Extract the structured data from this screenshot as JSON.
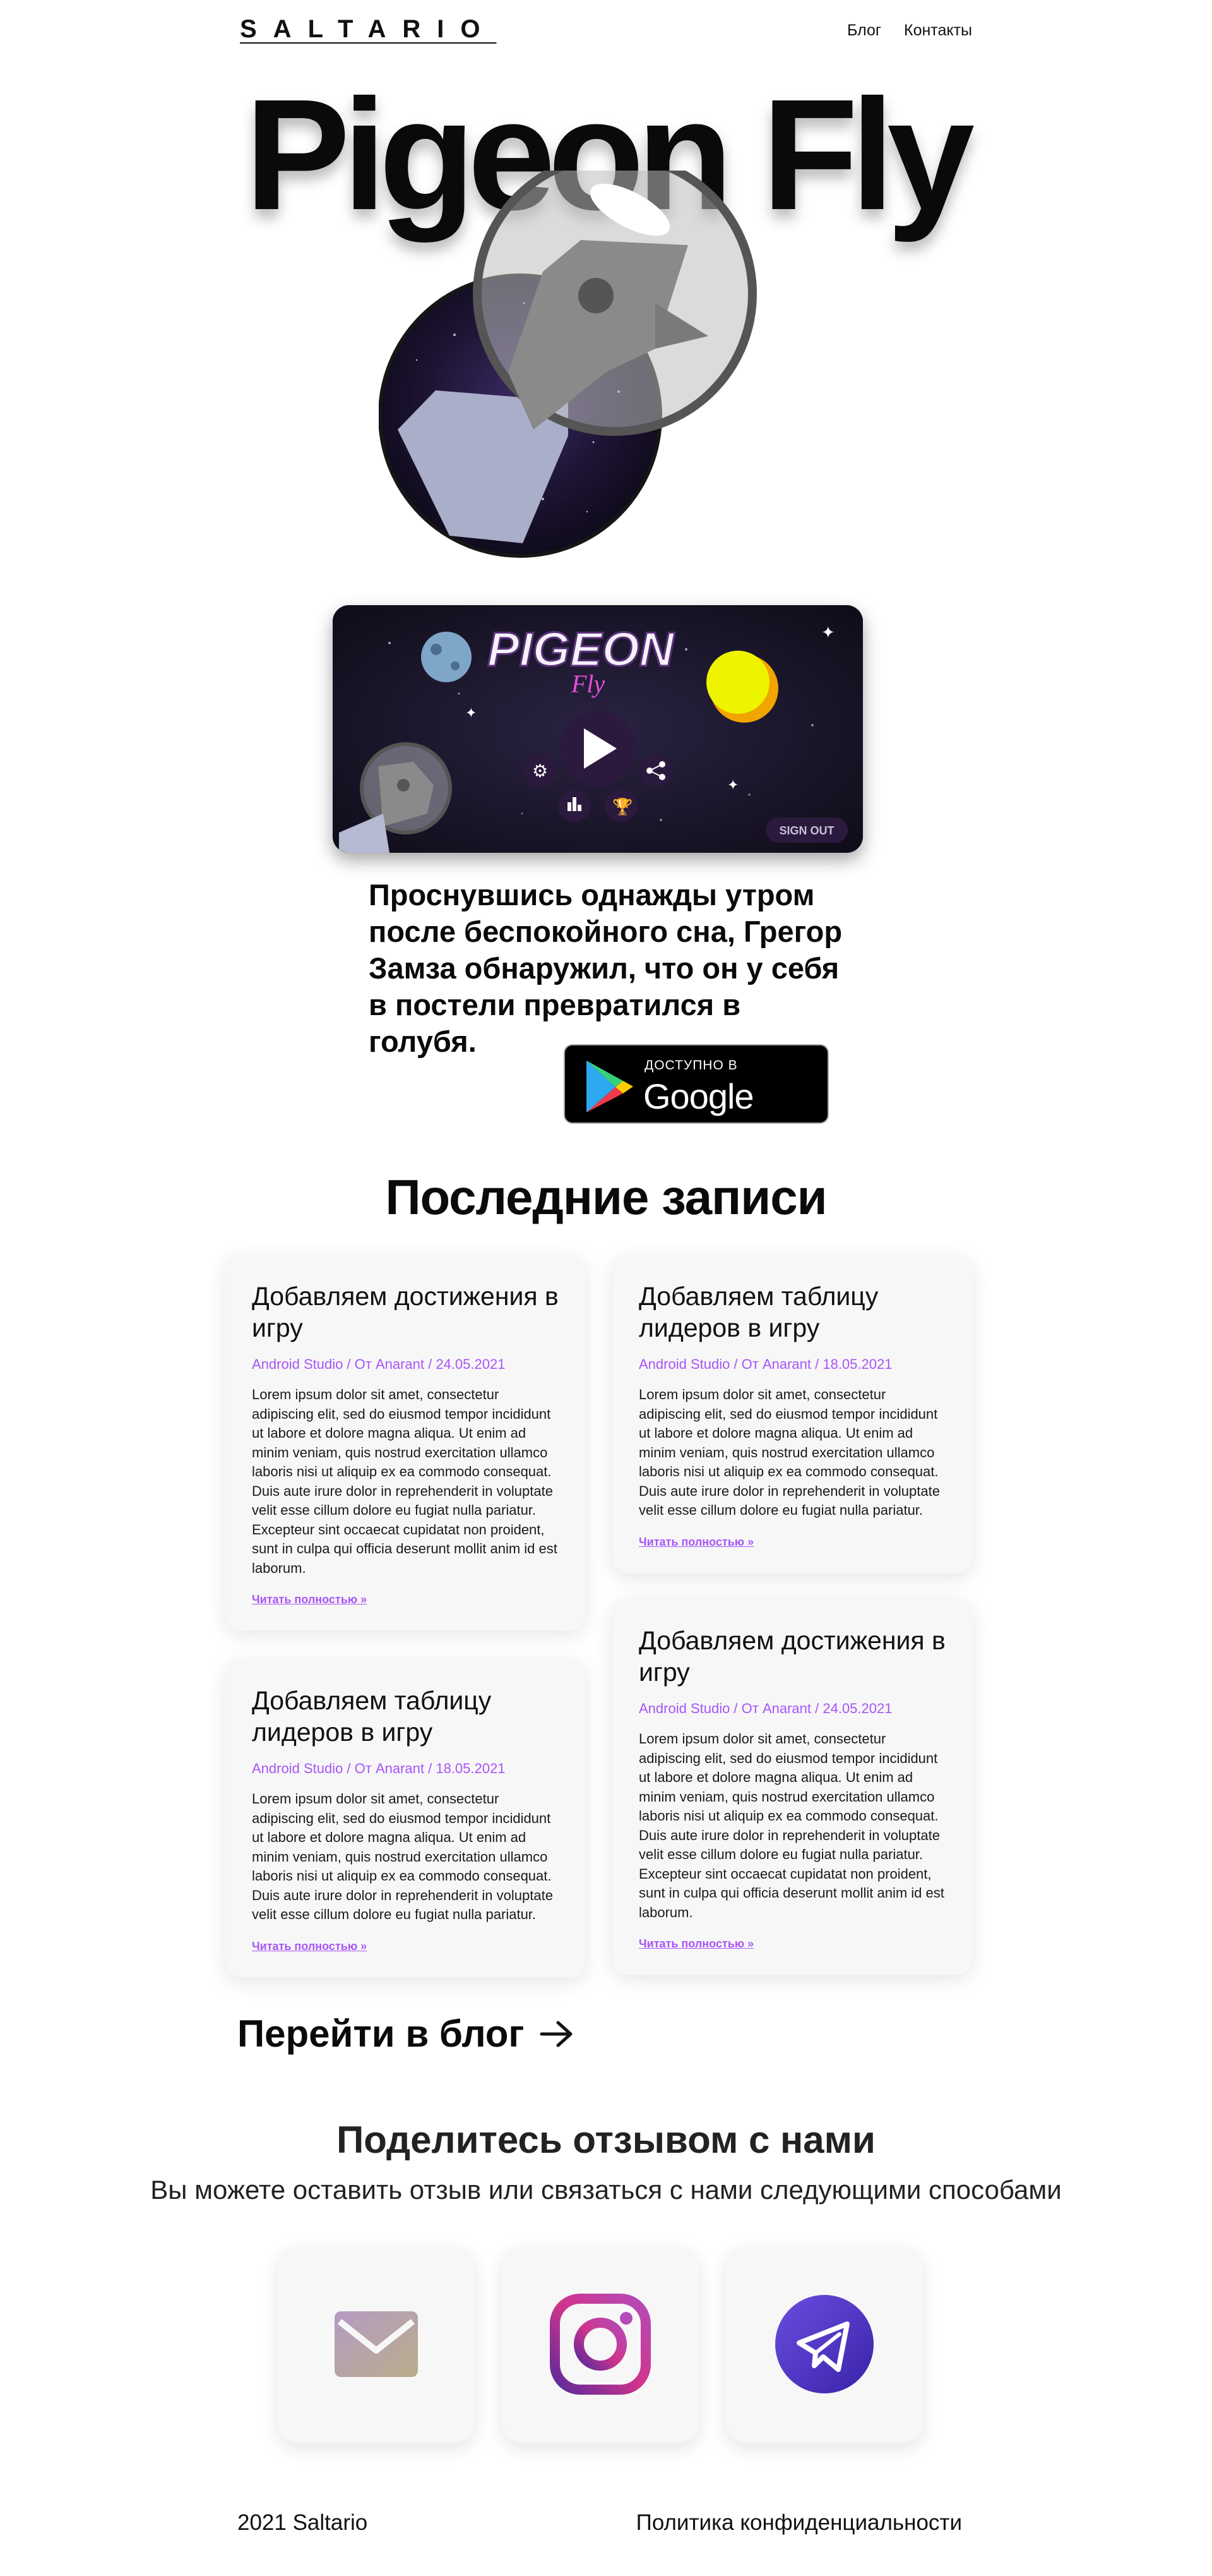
{
  "header": {
    "logo": "SALTARIO",
    "nav": {
      "blog": "Блог",
      "contacts": "Контакты"
    }
  },
  "hero": {
    "title": "Pigeon Fly"
  },
  "game_screen": {
    "logo_main": "PIGEON",
    "logo_sub": "Fly",
    "sign_out": "SIGN OUT"
  },
  "tagline": "Проснувшись однажды утром после беспокойного сна, Грегор Замза обнаружил, что он у себя в постели превратился в голубя.",
  "google_play": {
    "small": "ДОСТУПНО В",
    "big": "Google Play"
  },
  "latest": {
    "title": "Последние записи",
    "posts": [
      {
        "title": "Добавляем достижения в игру",
        "meta": "Android Studio / От Anarant / 24.05.2021",
        "body": "Lorem ipsum dolor sit amet, consectetur adipiscing elit, sed do eiusmod tempor incididunt ut labore et dolore magna aliqua. Ut enim ad minim veniam, quis nostrud exercitation ullamco laboris nisi ut aliquip ex ea commodo consequat. Duis aute irure dolor in reprehenderit in voluptate velit esse cillum dolore eu fugiat nulla pariatur. Excepteur sint occaecat cupidatat non proident, sunt in culpa qui officia deserunt mollit anim id est laborum.",
        "more": "Читать полностью »"
      },
      {
        "title": "Добавляем таблицу лидеров в игру",
        "meta": "Android Studio / От Anarant / 18.05.2021",
        "body": "Lorem ipsum dolor sit amet, consectetur adipiscing elit, sed do eiusmod tempor incididunt ut labore et dolore magna aliqua. Ut enim ad minim veniam, quis nostrud exercitation ullamco laboris nisi ut aliquip ex ea commodo consequat. Duis aute irure dolor in reprehenderit in voluptate velit esse cillum dolore eu fugiat nulla pariatur.",
        "more": "Читать полностью »"
      },
      {
        "title": "Добавляем таблицу лидеров в игру",
        "meta": "Android Studio / От Anarant / 18.05.2021",
        "body": "Lorem ipsum dolor sit amet, consectetur adipiscing elit, sed do eiusmod tempor incididunt ut labore et dolore magna aliqua. Ut enim ad minim veniam, quis nostrud exercitation ullamco laboris nisi ut aliquip ex ea commodo consequat. Duis aute irure dolor in reprehenderit in voluptate velit esse cillum dolore eu fugiat nulla pariatur.",
        "more": "Читать полностью »"
      },
      {
        "title": "Добавляем достижения в игру",
        "meta": "Android Studio / От Anarant / 24.05.2021",
        "body": "Lorem ipsum dolor sit amet, consectetur adipiscing elit, sed do eiusmod tempor incididunt ut labore et dolore magna aliqua. Ut enim ad minim veniam, quis nostrud exercitation ullamco laboris nisi ut aliquip ex ea commodo consequat. Duis aute irure dolor in reprehenderit in voluptate velit esse cillum dolore eu fugiat nulla pariatur. Excepteur sint occaecat cupidatat non proident, sunt in culpa qui officia deserunt mollit anim id est laborum.",
        "more": "Читать полностью »"
      }
    ]
  },
  "to_blog": "Перейти в блог",
  "share": {
    "title": "Поделитесь отзывом с нами",
    "subtitle": "Вы можете оставить отзыв или связаться с нами следующими способами",
    "icons": [
      "mail-icon",
      "instagram-icon",
      "telegram-icon"
    ]
  },
  "footer": {
    "copyright": "2021 Saltario",
    "privacy": "Политика конфиденциальности"
  },
  "colors": {
    "accent": "#a855f7",
    "card_bg": "#f7f7f7",
    "telegram": "#5b3fd1"
  }
}
